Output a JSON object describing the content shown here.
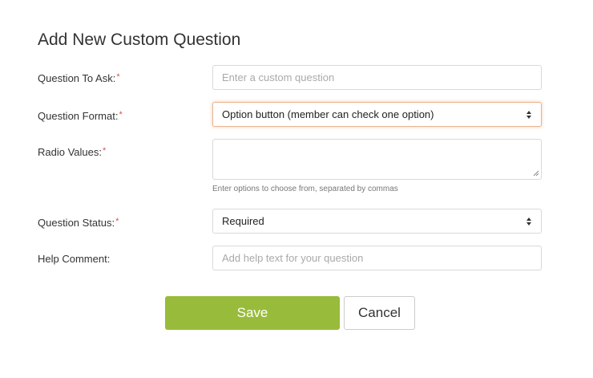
{
  "form": {
    "title": "Add New Custom Question",
    "required_marker": "*",
    "fields": {
      "question": {
        "label": "Question To Ask:",
        "value": "",
        "placeholder": "Enter a custom question"
      },
      "format": {
        "label": "Question Format:",
        "selected": "Option button (member can check one option)"
      },
      "radio_values": {
        "label": "Radio Values:",
        "value": "",
        "hint": "Enter options to choose from, separated by commas"
      },
      "status": {
        "label": "Question Status:",
        "selected": "Required"
      },
      "help_comment": {
        "label": "Help Comment:",
        "value": "",
        "placeholder": "Add help text for your question"
      }
    },
    "buttons": {
      "save": "Save",
      "cancel": "Cancel"
    }
  },
  "colors": {
    "save_button": "#99bb3b",
    "required_marker": "#d9534f",
    "focus_ring": "#e8b48f"
  },
  "icons": {
    "select_arrows": "chevron-updown-icon",
    "textarea_resize": "resize-grip-icon"
  }
}
